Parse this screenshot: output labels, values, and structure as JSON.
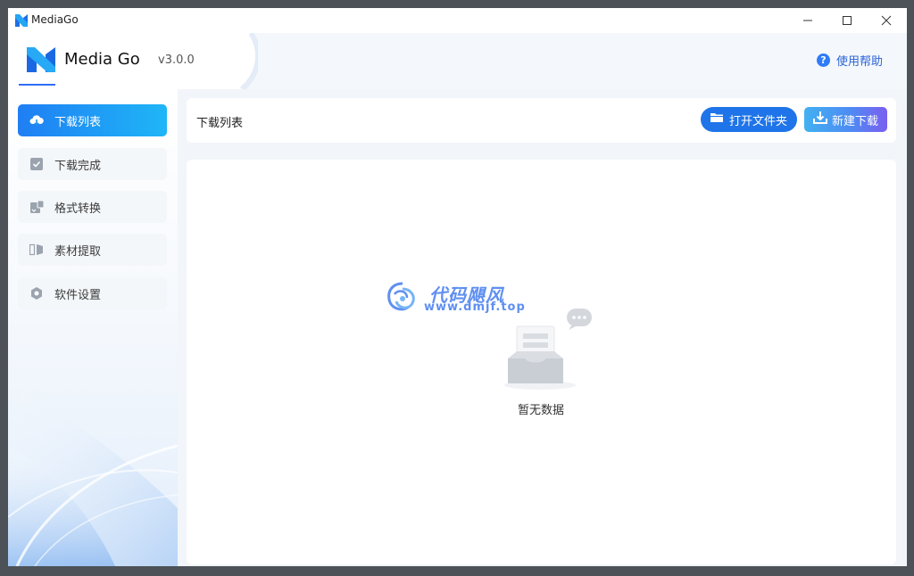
{
  "window": {
    "title": "MediaGo"
  },
  "titlebar_controls": {
    "minimize": "—",
    "maximize": "☐",
    "close": "✕"
  },
  "header": {
    "app_name": "Media Go",
    "version": "v3.0.0",
    "help_label": "使用帮助",
    "help_icon": "question-icon"
  },
  "sidebar": {
    "items": [
      {
        "label": "下载列表",
        "icon": "cloud-download-icon",
        "active": true
      },
      {
        "label": "下载完成",
        "icon": "check-box-icon",
        "active": false
      },
      {
        "label": "格式转换",
        "icon": "convert-icon",
        "active": false
      },
      {
        "label": "素材提取",
        "icon": "extract-icon",
        "active": false
      },
      {
        "label": "软件设置",
        "icon": "settings-icon",
        "active": false
      }
    ]
  },
  "main": {
    "title": "下载列表",
    "open_folder_label": "打开文件夹",
    "new_download_label": "新建下载",
    "empty_text": "暂无数据"
  },
  "watermark": {
    "title": "代码飓风",
    "url": "www.dmjf.top"
  },
  "colors": {
    "accent": "#1e74e8",
    "active_start": "#1f7ef3",
    "active_end": "#1fb6f7",
    "new_btn_end": "#7b5ff0"
  }
}
